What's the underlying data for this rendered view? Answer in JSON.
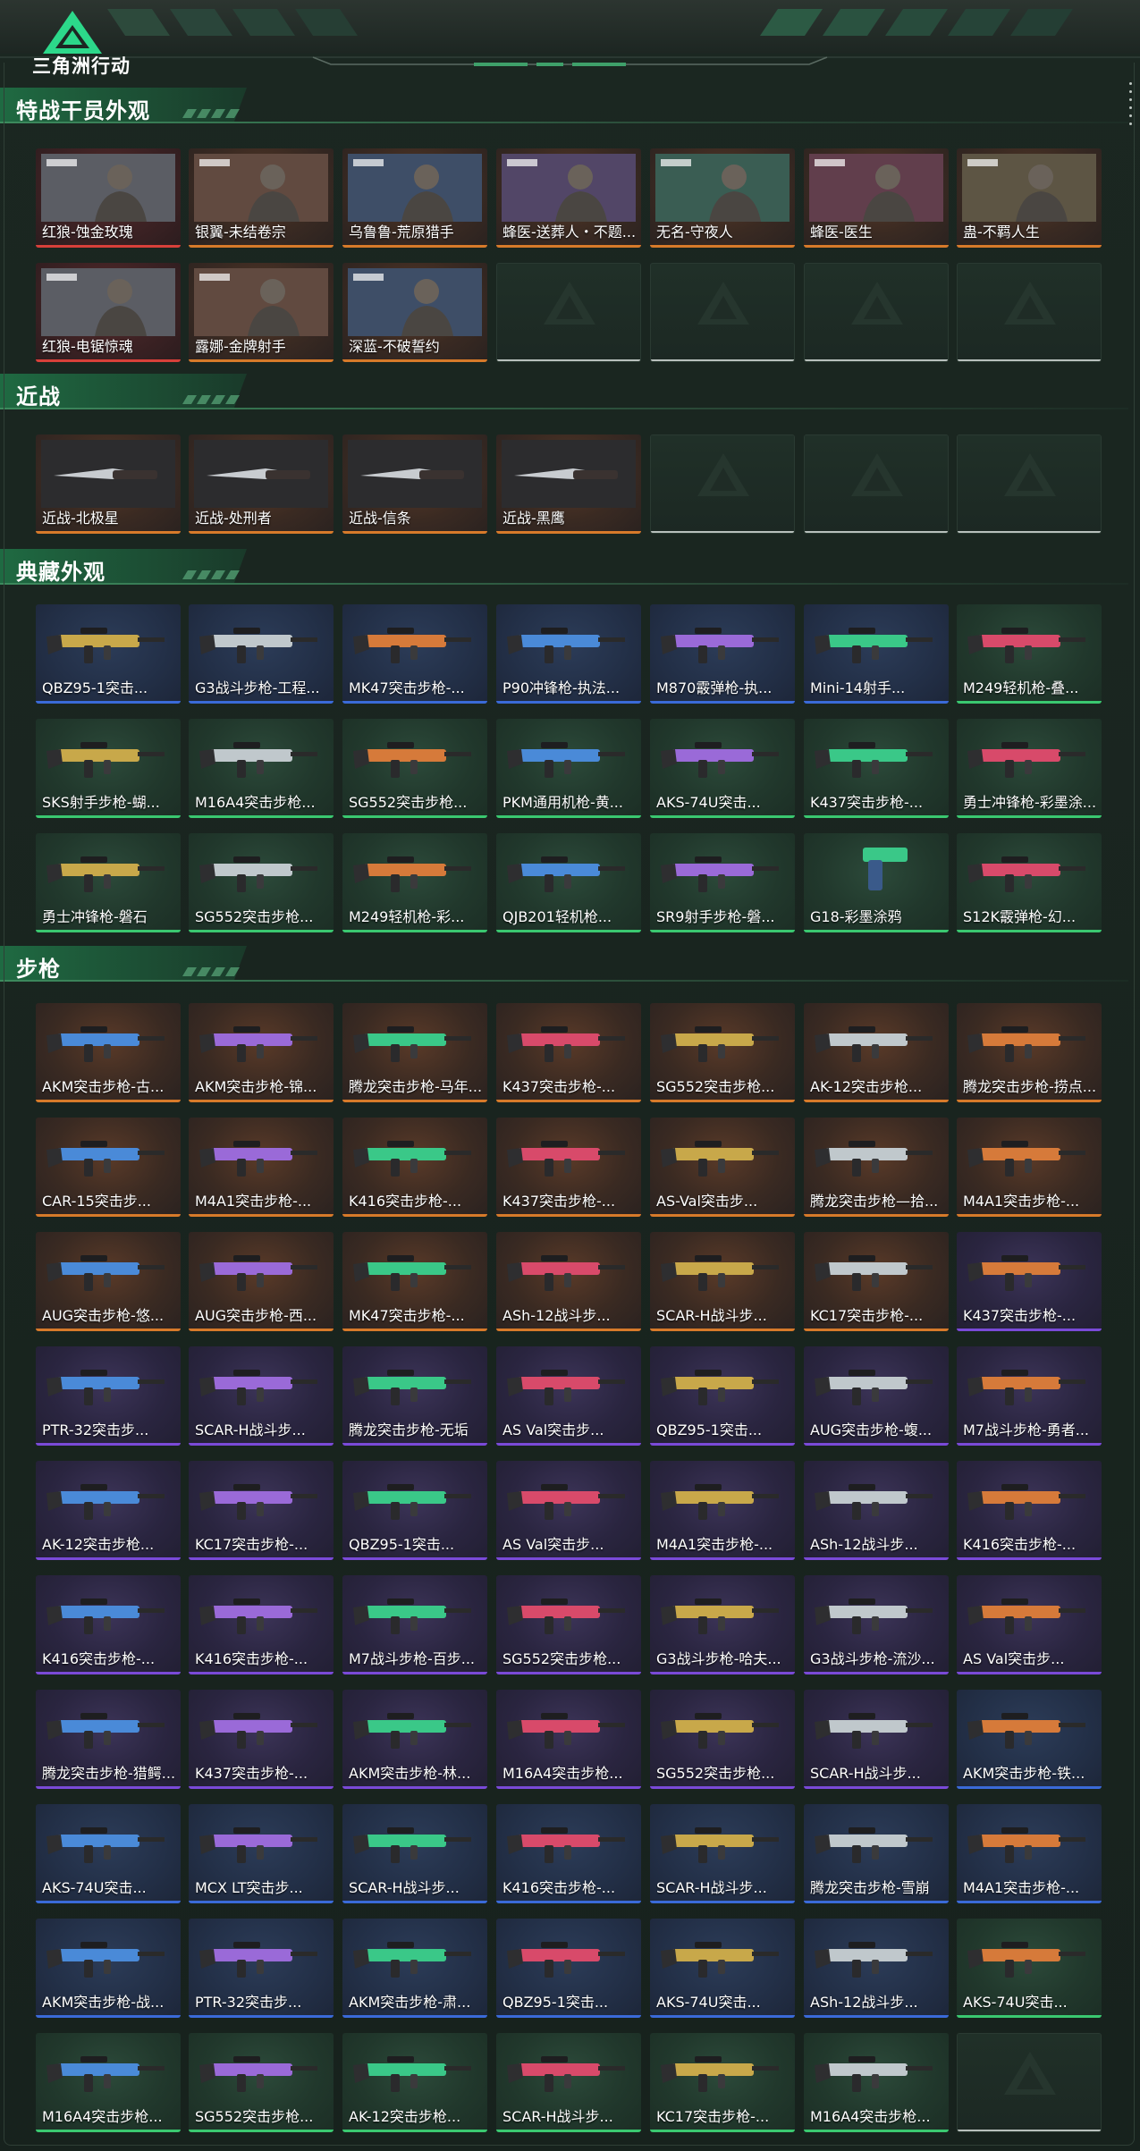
{
  "app": {
    "logo_text": "三角洲行动"
  },
  "colors": {
    "gold": "#d77a2a",
    "purple": "#7a4ad8",
    "blue": "#3a6ad8",
    "green": "#3ac870",
    "red": "#d8403a",
    "grey": "#bfbfbf",
    "accent": "#3c8a5d"
  },
  "sections": [
    {
      "title": "特战干员外观",
      "cards": [
        {
          "label": "红狼-蚀金玫瑰",
          "q": "red",
          "art": "operator"
        },
        {
          "label": "银翼-未结卷宗",
          "q": "gold",
          "art": "operator"
        },
        {
          "label": "乌鲁鲁-荒原猎手",
          "q": "gold",
          "art": "operator"
        },
        {
          "label": "蜂医-送葬人・不题...",
          "q": "gold",
          "art": "operator"
        },
        {
          "label": "无名-守夜人",
          "q": "gold",
          "art": "operator"
        },
        {
          "label": "蜂医-医生",
          "q": "gold",
          "art": "operator"
        },
        {
          "label": "蛊-不羁人生",
          "q": "gold",
          "art": "operator"
        },
        {
          "label": "红狼-电锯惊魂",
          "q": "red",
          "art": "operator"
        },
        {
          "label": "露娜-金牌射手",
          "q": "gold",
          "art": "operator"
        },
        {
          "label": "深蓝-不破誓约",
          "q": "gold",
          "art": "operator"
        },
        {
          "label": "",
          "q": "empty"
        },
        {
          "label": "",
          "q": "empty"
        },
        {
          "label": "",
          "q": "empty"
        },
        {
          "label": "",
          "q": "empty"
        }
      ]
    },
    {
      "title": "近战",
      "cards": [
        {
          "label": "近战-北极星",
          "q": "gold",
          "art": "knife"
        },
        {
          "label": "近战-处刑者",
          "q": "gold",
          "art": "knife"
        },
        {
          "label": "近战-信条",
          "q": "gold",
          "art": "knife"
        },
        {
          "label": "近战-黑鹰",
          "q": "gold",
          "art": "knife"
        },
        {
          "label": "",
          "q": "empty"
        },
        {
          "label": "",
          "q": "empty"
        },
        {
          "label": "",
          "q": "empty"
        }
      ]
    },
    {
      "title": "典藏外观",
      "cards": [
        {
          "label": "QBZ95-1突击...",
          "q": "blue",
          "art": "gun"
        },
        {
          "label": "G3战斗步枪-工程...",
          "q": "blue",
          "art": "gun"
        },
        {
          "label": "MK47突击步枪-...",
          "q": "blue",
          "art": "gun"
        },
        {
          "label": "P90冲锋枪-执法...",
          "q": "blue",
          "art": "gun"
        },
        {
          "label": "M870霰弹枪-执...",
          "q": "blue",
          "art": "gun"
        },
        {
          "label": "Mini-14射手...",
          "q": "blue",
          "art": "gun"
        },
        {
          "label": "M249轻机枪-叠...",
          "q": "green",
          "art": "gun"
        },
        {
          "label": "SKS射手步枪-蝴...",
          "q": "green",
          "art": "gun"
        },
        {
          "label": "M16A4突击步枪...",
          "q": "green",
          "art": "gun"
        },
        {
          "label": "SG552突击步枪...",
          "q": "green",
          "art": "gun"
        },
        {
          "label": "PKM通用机枪-黄...",
          "q": "green",
          "art": "gun"
        },
        {
          "label": "AKS-74U突击...",
          "q": "green",
          "art": "gun"
        },
        {
          "label": "K437突击步枪-...",
          "q": "green",
          "art": "gun"
        },
        {
          "label": "勇士冲锋枪-彩墨涂...",
          "q": "green",
          "art": "gun"
        },
        {
          "label": "勇士冲锋枪-磐石",
          "q": "green",
          "art": "gun"
        },
        {
          "label": "SG552突击步枪...",
          "q": "green",
          "art": "gun"
        },
        {
          "label": "M249轻机枪-彩...",
          "q": "green",
          "art": "gun"
        },
        {
          "label": "QJB201轻机枪...",
          "q": "green",
          "art": "gun"
        },
        {
          "label": "SR9射手步枪-磐...",
          "q": "green",
          "art": "gun"
        },
        {
          "label": "G18-彩墨涂鸦",
          "q": "green",
          "art": "pistol"
        },
        {
          "label": "S12K霰弹枪-幻...",
          "q": "green",
          "art": "gun"
        }
      ]
    },
    {
      "title": "步枪",
      "cards": [
        {
          "label": "AKM突击步枪-古...",
          "q": "gold",
          "art": "gun"
        },
        {
          "label": "AKM突击步枪-锦...",
          "q": "gold",
          "art": "gun"
        },
        {
          "label": "腾龙突击步枪-马年...",
          "q": "gold",
          "art": "gun"
        },
        {
          "label": "K437突击步枪-...",
          "q": "gold",
          "art": "gun"
        },
        {
          "label": "SG552突击步枪...",
          "q": "gold",
          "art": "gun"
        },
        {
          "label": "AK-12突击步枪...",
          "q": "gold",
          "art": "gun"
        },
        {
          "label": "腾龙突击步枪-捞点...",
          "q": "gold",
          "art": "gun"
        },
        {
          "label": "CAR-15突击步...",
          "q": "gold",
          "art": "gun"
        },
        {
          "label": "M4A1突击步枪-...",
          "q": "gold",
          "art": "gun"
        },
        {
          "label": "K416突击步枪-...",
          "q": "gold",
          "art": "gun"
        },
        {
          "label": "K437突击步枪-...",
          "q": "gold",
          "art": "gun"
        },
        {
          "label": "AS-Val突击步...",
          "q": "gold",
          "art": "gun"
        },
        {
          "label": "腾龙突击步枪—拾...",
          "q": "gold",
          "art": "gun"
        },
        {
          "label": "M4A1突击步枪-...",
          "q": "gold",
          "art": "gun"
        },
        {
          "label": "AUG突击步枪-悠...",
          "q": "gold",
          "art": "gun"
        },
        {
          "label": "AUG突击步枪-西...",
          "q": "gold",
          "art": "gun"
        },
        {
          "label": "MK47突击步枪-...",
          "q": "gold",
          "art": "gun"
        },
        {
          "label": "ASh-12战斗步...",
          "q": "gold",
          "art": "gun"
        },
        {
          "label": "SCAR-H战斗步...",
          "q": "gold",
          "art": "gun"
        },
        {
          "label": "KC17突击步枪-...",
          "q": "gold",
          "art": "gun"
        },
        {
          "label": "K437突击步枪-...",
          "q": "purple",
          "art": "gun"
        },
        {
          "label": "PTR-32突击步...",
          "q": "purple",
          "art": "gun"
        },
        {
          "label": "SCAR-H战斗步...",
          "q": "purple",
          "art": "gun"
        },
        {
          "label": "腾龙突击步枪-无垢",
          "q": "purple",
          "art": "gun"
        },
        {
          "label": "AS Val突击步...",
          "q": "purple",
          "art": "gun"
        },
        {
          "label": "QBZ95-1突击...",
          "q": "purple",
          "art": "gun"
        },
        {
          "label": "AUG突击步枪-蝮...",
          "q": "purple",
          "art": "gun"
        },
        {
          "label": "M7战斗步枪-勇者...",
          "q": "purple",
          "art": "gun"
        },
        {
          "label": "AK-12突击步枪...",
          "q": "purple",
          "art": "gun"
        },
        {
          "label": "KC17突击步枪-...",
          "q": "purple",
          "art": "gun"
        },
        {
          "label": "QBZ95-1突击...",
          "q": "purple",
          "art": "gun"
        },
        {
          "label": "AS Val突击步...",
          "q": "purple",
          "art": "gun"
        },
        {
          "label": "M4A1突击步枪-...",
          "q": "purple",
          "art": "gun"
        },
        {
          "label": "ASh-12战斗步...",
          "q": "purple",
          "art": "gun"
        },
        {
          "label": "K416突击步枪-...",
          "q": "purple",
          "art": "gun"
        },
        {
          "label": "K416突击步枪-...",
          "q": "purple",
          "art": "gun"
        },
        {
          "label": "K416突击步枪-...",
          "q": "purple",
          "art": "gun"
        },
        {
          "label": "M7战斗步枪-百步...",
          "q": "purple",
          "art": "gun"
        },
        {
          "label": "SG552突击步枪...",
          "q": "purple",
          "art": "gun"
        },
        {
          "label": "G3战斗步枪-哈夫...",
          "q": "purple",
          "art": "gun"
        },
        {
          "label": "G3战斗步枪-流沙...",
          "q": "purple",
          "art": "gun"
        },
        {
          "label": "AS Val突击步...",
          "q": "purple",
          "art": "gun"
        },
        {
          "label": "腾龙突击步枪-猎鳄...",
          "q": "purple",
          "art": "gun"
        },
        {
          "label": "K437突击步枪-...",
          "q": "purple",
          "art": "gun"
        },
        {
          "label": "AKM突击步枪-林...",
          "q": "purple",
          "art": "gun"
        },
        {
          "label": "M16A4突击步枪...",
          "q": "purple",
          "art": "gun"
        },
        {
          "label": "SG552突击步枪...",
          "q": "purple",
          "art": "gun"
        },
        {
          "label": "SCAR-H战斗步...",
          "q": "purple",
          "art": "gun"
        },
        {
          "label": "AKM突击步枪-铁...",
          "q": "blue",
          "art": "gun"
        },
        {
          "label": "AKS-74U突击...",
          "q": "blue",
          "art": "gun"
        },
        {
          "label": "MCX LT突击步...",
          "q": "blue",
          "art": "gun"
        },
        {
          "label": "SCAR-H战斗步...",
          "q": "blue",
          "art": "gun"
        },
        {
          "label": "K416突击步枪-...",
          "q": "blue",
          "art": "gun"
        },
        {
          "label": "SCAR-H战斗步...",
          "q": "blue",
          "art": "gun"
        },
        {
          "label": "腾龙突击步枪-雪崩",
          "q": "blue",
          "art": "gun"
        },
        {
          "label": "M4A1突击步枪-...",
          "q": "blue",
          "art": "gun"
        },
        {
          "label": "AKM突击步枪-战...",
          "q": "blue",
          "art": "gun"
        },
        {
          "label": "PTR-32突击步...",
          "q": "blue",
          "art": "gun"
        },
        {
          "label": "AKM突击步枪-肃...",
          "q": "blue",
          "art": "gun"
        },
        {
          "label": "QBZ95-1突击...",
          "q": "blue",
          "art": "gun"
        },
        {
          "label": "AKS-74U突击...",
          "q": "blue",
          "art": "gun"
        },
        {
          "label": "ASh-12战斗步...",
          "q": "blue",
          "art": "gun"
        },
        {
          "label": "AKS-74U突击...",
          "q": "green",
          "art": "gun"
        },
        {
          "label": "M16A4突击步枪...",
          "q": "green",
          "art": "gun"
        },
        {
          "label": "SG552突击步枪...",
          "q": "green",
          "art": "gun"
        },
        {
          "label": "AK-12突击步枪...",
          "q": "green",
          "art": "gun"
        },
        {
          "label": "SCAR-H战斗步...",
          "q": "green",
          "art": "gun"
        },
        {
          "label": "KC17突击步枪-...",
          "q": "green",
          "art": "gun"
        },
        {
          "label": "M16A4突击步枪...",
          "q": "green",
          "art": "gun"
        },
        {
          "label": "",
          "q": "empty"
        }
      ]
    }
  ]
}
